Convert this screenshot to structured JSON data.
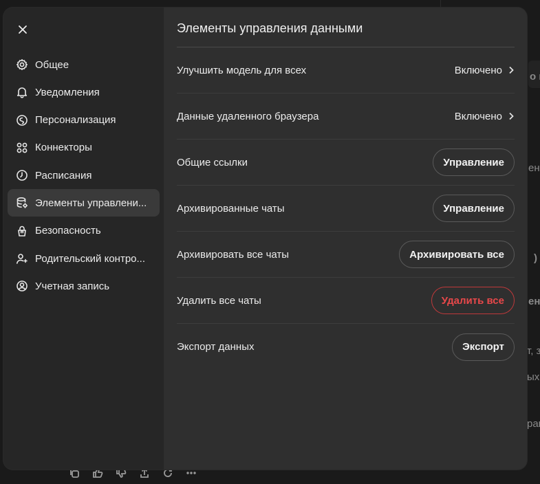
{
  "background": {
    "fragments": [
      "о во",
      "ене",
      ")",
      "ени",
      "т, з",
      "ых(",
      "ран"
    ]
  },
  "modal": {
    "close_label": "×",
    "sidebar": {
      "items": [
        {
          "label": "Общее",
          "icon": "gear-icon"
        },
        {
          "label": "Уведомления",
          "icon": "bell-icon"
        },
        {
          "label": "Персонализация",
          "icon": "personalization-icon"
        },
        {
          "label": "Коннекторы",
          "icon": "connectors-icon"
        },
        {
          "label": "Расписания",
          "icon": "clock-icon"
        },
        {
          "label": "Элементы управлени...",
          "icon": "database-settings-icon",
          "active": true
        },
        {
          "label": "Безопасность",
          "icon": "lock-icon"
        },
        {
          "label": "Родительский контро...",
          "icon": "parental-icon"
        },
        {
          "label": "Учетная запись",
          "icon": "account-icon"
        }
      ]
    },
    "title": "Элементы управления данными",
    "rows": [
      {
        "label": "Улучшить модель для всех",
        "value": "Включено"
      },
      {
        "label": "Данные удаленного браузера",
        "value": "Включено"
      },
      {
        "label": "Общие ссылки",
        "button": "Управление"
      },
      {
        "label": "Архивированные чаты",
        "button": "Управление"
      },
      {
        "label": "Архивировать все чаты",
        "button": "Архивировать все"
      },
      {
        "label": "Удалить все чаты",
        "button": "Удалить все"
      },
      {
        "label": "Экспорт данных",
        "button": "Экспорт"
      }
    ]
  },
  "colors": {
    "danger": "#e8484a",
    "sidebar_bg": "#262626",
    "content_bg": "#2f2f2f"
  }
}
